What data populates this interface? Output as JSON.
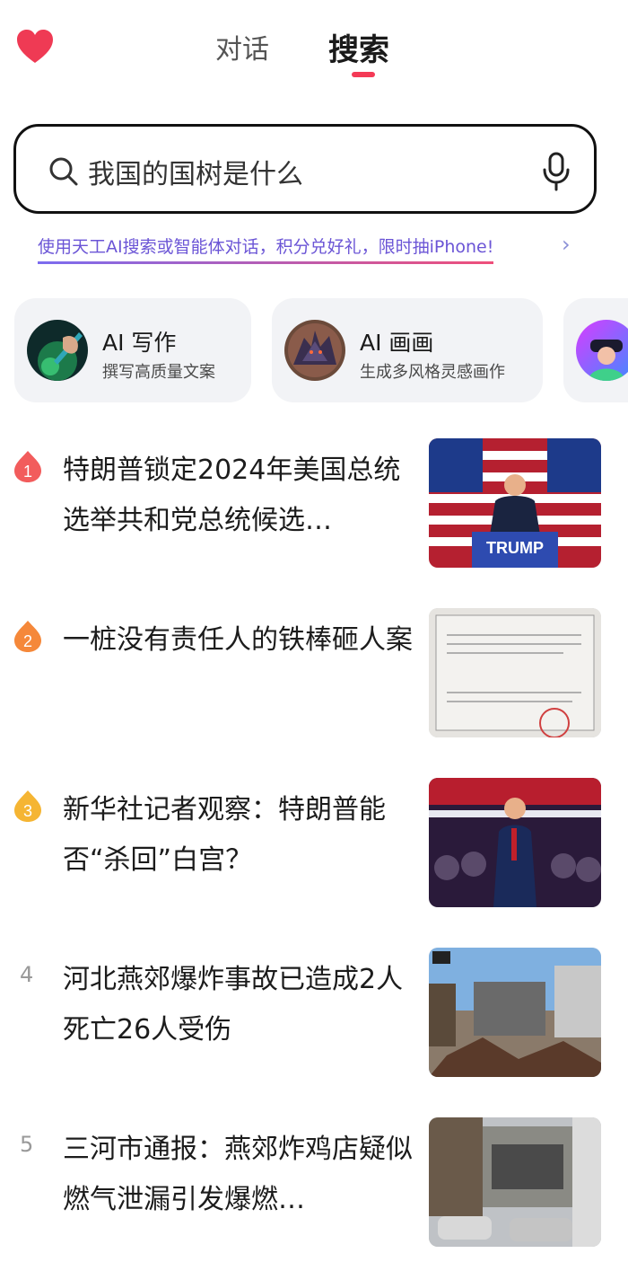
{
  "header": {
    "tabs": [
      {
        "label": "对话",
        "active": false
      },
      {
        "label": "搜索",
        "active": true
      }
    ],
    "accent_color": "#f43a56"
  },
  "search": {
    "value": "我国的国树是什么",
    "icon_left": "search-icon",
    "icon_right": "microphone-icon"
  },
  "promo": {
    "text": "使用天工AI搜索或智能体对话，积分兑好礼，限时抽iPhone!",
    "arrow": "›"
  },
  "cards": [
    {
      "title": "AI 写作",
      "subtitle": "撰写高质量文案"
    },
    {
      "title": "AI 画画",
      "subtitle": "生成多风格灵感画作"
    },
    {
      "title": "",
      "subtitle": ""
    }
  ],
  "news": [
    {
      "rank": "1",
      "title": "特朗普锁定2024年美国总统选举共和党总统候选…",
      "badge_color": "#f25c5c"
    },
    {
      "rank": "2",
      "title": "一桩没有责任人的铁棒砸人案",
      "badge_color": "#f5883a"
    },
    {
      "rank": "3",
      "title": "新华社记者观察：特朗普能否“杀回”白宫？",
      "badge_color": "#f5b533"
    },
    {
      "rank": "4",
      "title": "河北燕郊爆炸事故已造成2人死亡26人受伤"
    },
    {
      "rank": "5",
      "title": "三河市通报：燕郊炸鸡店疑似燃气泄漏引发爆燃…"
    }
  ],
  "thumbnails": {
    "trump_podium_text": "TRUMP"
  }
}
